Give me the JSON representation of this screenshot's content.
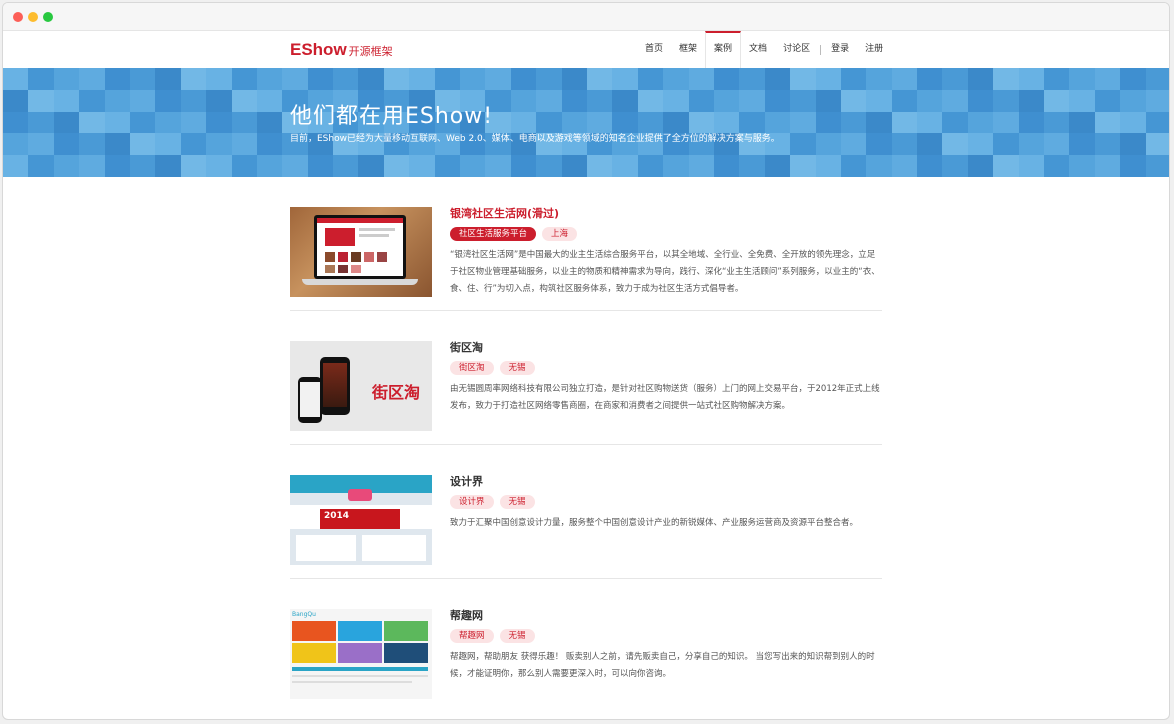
{
  "window": {
    "controls": [
      "close",
      "minimize",
      "zoom"
    ]
  },
  "brand": {
    "logo_main": "EShow",
    "logo_sub": "开源框架",
    "color": "#cc1e2d"
  },
  "nav": {
    "items": [
      {
        "label": "首页",
        "active": false
      },
      {
        "label": "框架",
        "active": false
      },
      {
        "label": "案例",
        "active": true
      },
      {
        "label": "文档",
        "active": false
      },
      {
        "label": "讨论区",
        "active": false
      },
      {
        "label": "登录",
        "active": false
      },
      {
        "label": "注册",
        "active": false
      }
    ]
  },
  "hero": {
    "title": "他们都在用EShow!",
    "subtitle": "目前，EShow已经为大量移动互联网、Web 2.0、媒体、电商以及游戏等领域的知名企业提供了全方位的解决方案与服务。",
    "color": "#4e9ed8"
  },
  "cases": [
    {
      "title": "银湾社区生活网(滑过)",
      "tags": [
        "社区生活服务平台",
        "上海"
      ],
      "description": "“银湾社区生活网”是中国最大的业主生活综合服务平台，以其全地域、全行业、全免费、全开放的领先理念，立足于社区物业管理基础服务，以业主的物质和精神需求为导向，践行、深化“业主生活顾问”系列服务，以业主的“衣、食、住、行”为切入点，构筑社区服务体系，致力于成为社区生活方式倡导者。"
    },
    {
      "title": "街区淘",
      "thumb_text": "街区淘",
      "tags": [
        "街区淘",
        "无锡"
      ],
      "description": "由无锡圆周率网络科技有限公司独立打造，是针对社区购物送货（服务）上门的网上交易平台，于2012年正式上线发布，致力于打造社区网络零售商圈，在商家和消费者之间提供一站式社区购物解决方案。"
    },
    {
      "title": "设计界",
      "thumb_text": "2014",
      "tags": [
        "设计界",
        "无锡"
      ],
      "description": "致力于汇聚中国创意设计力量，服务整个中国创意设计产业的新锐媒体、产业服务运营商及资源平台整合者。"
    },
    {
      "title": "帮趣网",
      "thumb_text": "BangQu",
      "tags": [
        "帮趣网",
        "无锡"
      ],
      "description": "帮趣网，帮助朋友 获得乐趣！ 贩卖别人之前，请先贩卖自己，分享自己的知识。 当您写出来的知识帮到别人的时候，才能证明你，那么别人需要更深入时，可以向你咨询。"
    }
  ]
}
